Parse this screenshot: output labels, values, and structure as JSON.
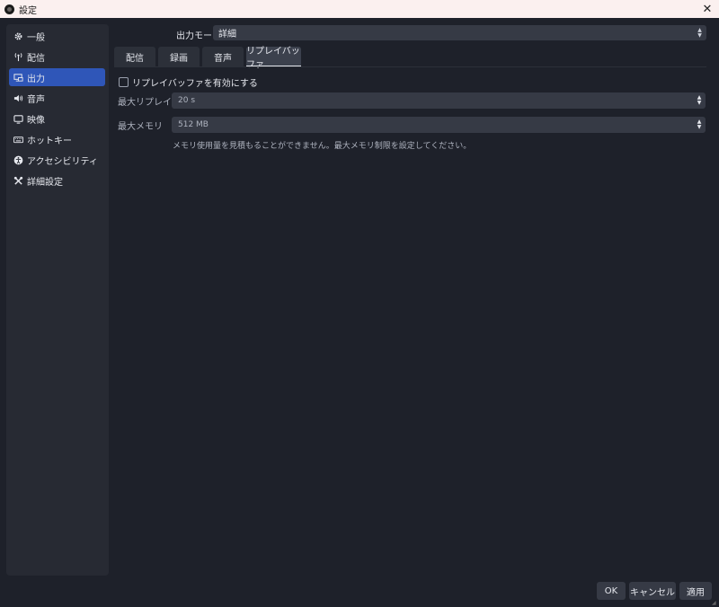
{
  "window": {
    "title": "設定"
  },
  "sidebar": {
    "items": [
      {
        "label": "一般",
        "icon": "gear-icon"
      },
      {
        "label": "配信",
        "icon": "broadcast-icon"
      },
      {
        "label": "出力",
        "icon": "output-icon",
        "active": true
      },
      {
        "label": "音声",
        "icon": "speaker-icon"
      },
      {
        "label": "映像",
        "icon": "monitor-icon"
      },
      {
        "label": "ホットキー",
        "icon": "keyboard-icon"
      },
      {
        "label": "アクセシビリティ",
        "icon": "accessibility-icon"
      },
      {
        "label": "詳細設定",
        "icon": "tools-icon"
      }
    ]
  },
  "output_mode": {
    "label": "出力モード",
    "value": "詳細"
  },
  "tabs": [
    {
      "label": "配信"
    },
    {
      "label": "録画"
    },
    {
      "label": "音声"
    },
    {
      "label": "リプレイバッファ",
      "active": true
    }
  ],
  "replay": {
    "enable_label": "リプレイバッファを有効にする",
    "max_time_label": "最大リプレイ時間",
    "max_time_value": "20 s",
    "max_memory_label": "最大メモリ",
    "max_memory_value": "512 MB",
    "hint": "メモリ使用量を見積もることができません。最大メモリ制限を設定してください。"
  },
  "footer": {
    "ok": "OK",
    "cancel": "キャンセル",
    "apply": "適用"
  },
  "colors": {
    "accent": "#2f56b8",
    "background": "#1e212a",
    "panel": "#272a33",
    "control": "#363a45",
    "titlebar": "#fbf0ef"
  }
}
